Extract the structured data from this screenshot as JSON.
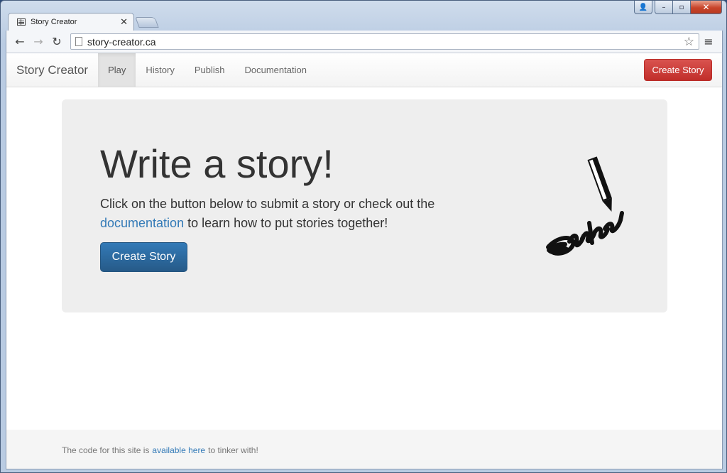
{
  "browser": {
    "tab_title": "Story Creator",
    "tab_close": "✕",
    "url": "story-creator.ca",
    "back": "←",
    "forward": "→",
    "reload": "↻",
    "star": "☆",
    "menu": "≡",
    "win_user": "👤",
    "win_min": "–",
    "win_max": "▫",
    "win_close": "✕"
  },
  "navbar": {
    "brand": "Story Creator",
    "links": [
      "Play",
      "History",
      "Publish",
      "Documentation"
    ],
    "active": "Play",
    "create_button": "Create Story"
  },
  "jumbotron": {
    "title": "Write a story!",
    "text_before": "Click on the button below to submit a story or check out the ",
    "link": "documentation",
    "text_after": " to learn how to put stories together!",
    "button": "Create Story",
    "illustration": "pen-writing-icon"
  },
  "footer": {
    "text_before": "The code for this site is",
    "link": "available here",
    "text_after": "to tinker with!"
  }
}
